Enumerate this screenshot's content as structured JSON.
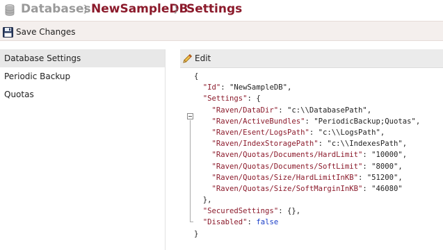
{
  "breadcrumb": {
    "databases": "Databases",
    "separator": "}",
    "database": "NewSampleDB",
    "page": "Settings"
  },
  "toolbar": {
    "save_label": "Save Changes"
  },
  "sidebar": {
    "items": [
      {
        "label": "Database Settings",
        "active": true
      },
      {
        "label": "Periodic Backup",
        "active": false
      },
      {
        "label": "Quotas",
        "active": false
      }
    ]
  },
  "editor": {
    "edit_label": "Edit",
    "lines": [
      {
        "indent": 0,
        "key": "",
        "value": "{",
        "type": "punct"
      },
      {
        "indent": 1,
        "key": "\"Id\"",
        "value": "\"NewSampleDB\",",
        "type": "pair"
      },
      {
        "indent": 1,
        "key": "\"Settings\"",
        "value": "{",
        "type": "pair"
      },
      {
        "indent": 2,
        "key": "\"Raven/DataDir\"",
        "value": "\"c:\\\\DatabasePath\",",
        "type": "pair"
      },
      {
        "indent": 2,
        "key": "\"Raven/ActiveBundles\"",
        "value": "\"PeriodicBackup;Quotas\",",
        "type": "pair"
      },
      {
        "indent": 2,
        "key": "\"Raven/Esent/LogsPath\"",
        "value": "\"c:\\\\LogsPath\",",
        "type": "pair"
      },
      {
        "indent": 2,
        "key": "\"Raven/IndexStoragePath\"",
        "value": "\"c:\\\\IndexesPath\",",
        "type": "pair"
      },
      {
        "indent": 2,
        "key": "\"Raven/Quotas/Documents/HardLimit\"",
        "value": "\"10000\",",
        "type": "pair"
      },
      {
        "indent": 2,
        "key": "\"Raven/Quotas/Documents/SoftLimit\"",
        "value": "\"8000\",",
        "type": "pair"
      },
      {
        "indent": 2,
        "key": "\"Raven/Quotas/Size/HardLimitInKB\"",
        "value": "\"51200\",",
        "type": "pair"
      },
      {
        "indent": 2,
        "key": "\"Raven/Quotas/Size/SoftMarginInKB\"",
        "value": "\"46080\"",
        "type": "pair"
      },
      {
        "indent": 1,
        "key": "",
        "value": "},",
        "type": "punct"
      },
      {
        "indent": 1,
        "key": "\"SecuredSettings\"",
        "value": "{},",
        "type": "pair"
      },
      {
        "indent": 1,
        "key": "\"Disabled\"",
        "value": "false",
        "type": "keyword"
      },
      {
        "indent": 0,
        "key": "",
        "value": "}",
        "type": "punct"
      }
    ]
  },
  "colors": {
    "accent": "#8b1a2b",
    "muted": "#9a9a9a",
    "keyword": "#1a3ec8",
    "toolbar_bg": "#f4efed",
    "active_item_bg": "#e8e8e8"
  },
  "icons": {
    "database": "database-icon",
    "save": "floppy-disk-icon",
    "edit": "pencil-icon",
    "fold": "collapse-icon"
  }
}
